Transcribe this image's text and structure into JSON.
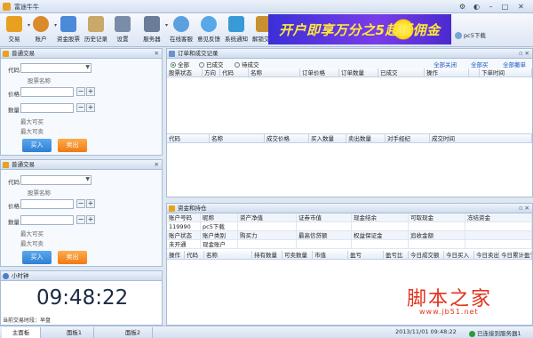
{
  "window": {
    "title": "富途牛牛"
  },
  "toolbar": {
    "items": [
      {
        "label": "交易",
        "icon": "trade-icon",
        "color": "#e8a020"
      },
      {
        "label": "账户",
        "icon": "account-icon",
        "color": "#d98a2a"
      },
      {
        "label": "资金股票",
        "icon": "funds-icon",
        "color": "#4a8ad8"
      },
      {
        "label": "历史记录",
        "icon": "history-icon",
        "color": "#c9a86a"
      },
      {
        "label": "设置",
        "icon": "settings-icon",
        "color": "#7a8ca8"
      },
      {
        "label": "服务器",
        "icon": "server-icon",
        "color": "#6a7c98"
      },
      {
        "label": "在线客服",
        "icon": "service-icon",
        "color": "#5aa0e0"
      },
      {
        "label": "意见反馈",
        "icon": "feedback-icon",
        "color": "#58a8e8"
      },
      {
        "label": "系统通知",
        "icon": "notice-icon",
        "color": "#3a9ad8"
      },
      {
        "label": "解锁交易",
        "icon": "lock-icon",
        "color": "#c89030"
      }
    ]
  },
  "banner": {
    "text": "开户即享万分之5超低佣金"
  },
  "user": {
    "name": "pc5下载"
  },
  "order_panels": [
    {
      "title": "普通交易",
      "code_label": "代码",
      "stock_name_label": "股票名称",
      "price_label": "价格",
      "qty_label": "数量",
      "max_buy": "最大可买",
      "max_sell": "最大可卖",
      "buy": "买入",
      "sell": "卖出"
    },
    {
      "title": "普通交易",
      "code_label": "代码",
      "stock_name_label": "股票名称",
      "price_label": "价格",
      "qty_label": "数量",
      "max_buy": "最大可买",
      "max_sell": "最大可卖",
      "buy": "买入",
      "sell": "卖出"
    }
  ],
  "clock": {
    "title": "小时钟",
    "time": "09:48:22",
    "session": "当前交易时段：早盘"
  },
  "orders": {
    "title": "订单和成交记录",
    "filters": [
      "全部",
      "已成交",
      "待成交"
    ],
    "links": [
      "全部关闭",
      "全部买",
      "全部撤单"
    ],
    "order_columns": [
      "股票状态",
      "方向",
      "代码",
      "名称",
      "订单价格",
      "订单数量",
      "已成交",
      "操作",
      "",
      "下单时间"
    ],
    "deal_columns": [
      "代码",
      "名称",
      "成交价格",
      "买入数量",
      "卖出数量",
      "对手经纪",
      "成交时间"
    ]
  },
  "funds": {
    "title": "资金和持仓",
    "rows": [
      [
        "账户号码",
        "昵称",
        "资产净值",
        "证券市值",
        "现金结余",
        "可取现金",
        "冻结资金"
      ],
      [
        "119990",
        "pc5下载",
        "",
        "",
        "",
        "",
        ""
      ],
      [
        "账户状态",
        "账户类别",
        "购买力",
        "最高信贷额",
        "权益保证金",
        "追收金额",
        ""
      ],
      [
        "未开通",
        "现金账户",
        "",
        "",
        "",
        "",
        ""
      ]
    ],
    "position_columns": [
      "操作",
      "代码",
      "名称",
      "持有数量",
      "可卖数量",
      "市值",
      "盈亏",
      "盈亏比",
      "今日成交额",
      "今日买入",
      "今日卖出",
      "今日累计盈亏"
    ]
  },
  "statusbar": {
    "tabs": [
      "主面板",
      "面板1",
      "面板2"
    ],
    "datetime": "2013/11/01  09:48:22",
    "connection": "已连接到服务器1"
  },
  "watermark": {
    "text": "脚本之家",
    "url": "www.jb51.net"
  }
}
